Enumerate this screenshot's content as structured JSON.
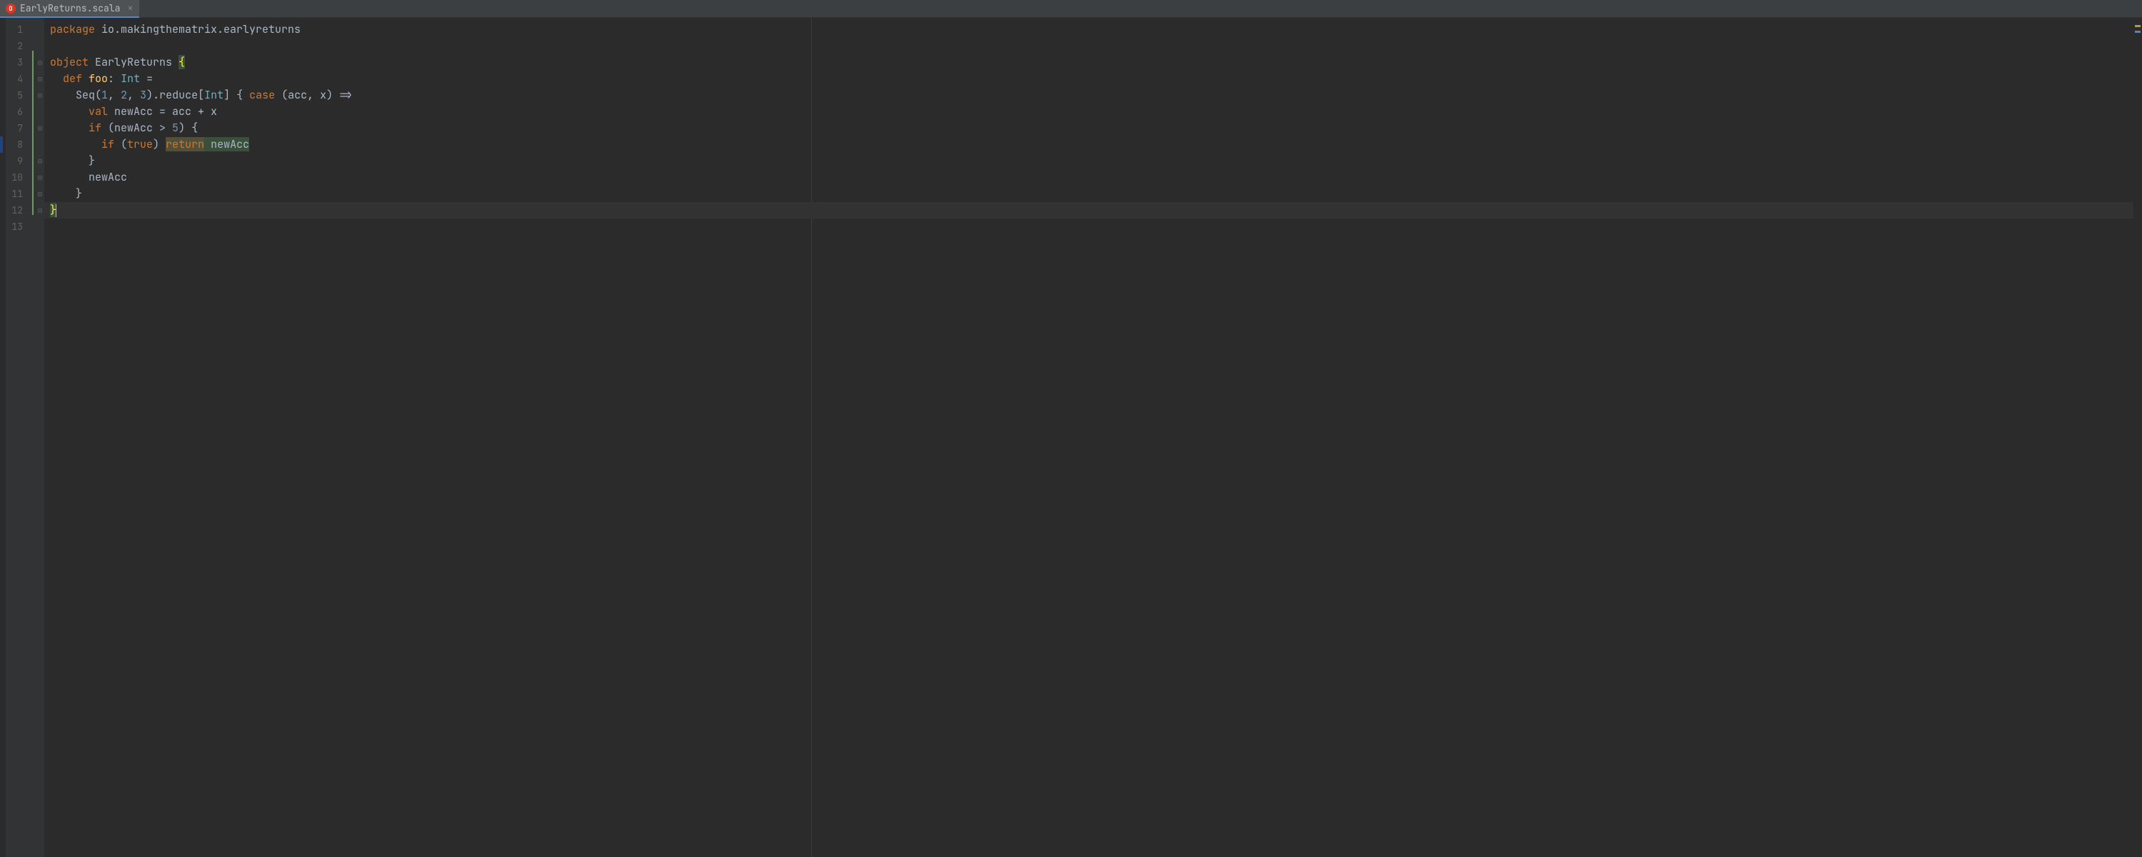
{
  "tab": {
    "filename": "EarlyReturns.scala",
    "icon_letter": "O"
  },
  "gutter": {
    "lines": [
      "1",
      "2",
      "3",
      "4",
      "5",
      "6",
      "7",
      "8",
      "9",
      "10",
      "11",
      "12",
      "13"
    ]
  },
  "code": {
    "l1": {
      "kw": "package",
      "rest": " io.makingthematrix.earlyreturns"
    },
    "l3": {
      "kw": "object",
      "name": " EarlyReturns ",
      "brace": "{"
    },
    "l4": {
      "indent": "  ",
      "kw": "def",
      "fn": " foo",
      "colon": ": ",
      "type": "Int",
      "eq": " ="
    },
    "l5": {
      "indent": "    ",
      "seq": "Seq(",
      "n1": "1",
      "c1": ", ",
      "n2": "2",
      "c2": ", ",
      "n3": "3",
      "after": ").reduce[",
      "type": "Int",
      "close": "] { ",
      "kw": "case",
      "params": " (acc, x) =>"
    },
    "l6": {
      "indent": "      ",
      "kw": "val",
      "rest": " newAcc = acc + x"
    },
    "l7": {
      "indent": "      ",
      "kw": "if",
      "pre": " (newAcc > ",
      "n": "5",
      "post": ") {"
    },
    "l8": {
      "indent": "        ",
      "kw1": "if",
      "paren": " (",
      "kw2": "true",
      "close": ") ",
      "ret": "return",
      "sp": " ",
      "expr": "newAcc"
    },
    "l9": {
      "indent": "      ",
      "brace": "}"
    },
    "l10": {
      "indent": "      ",
      "txt": "newAcc"
    },
    "l11": {
      "indent": "    ",
      "brace": "}"
    },
    "l12": {
      "brace": "}"
    }
  }
}
